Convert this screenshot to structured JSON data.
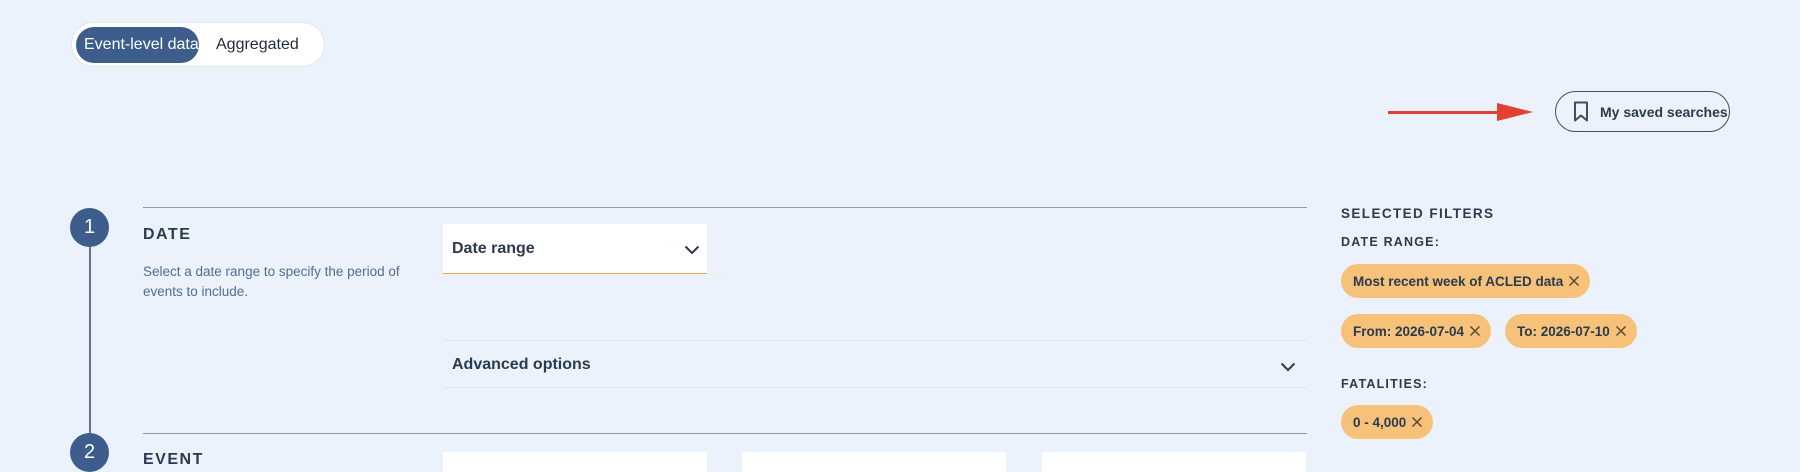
{
  "view_toggle": {
    "active": "Event-level data",
    "inactive": "Aggregated"
  },
  "saved_searches": {
    "label": "My saved searches",
    "icon": "bookmark-icon"
  },
  "annotation": {
    "color": "#e3402f"
  },
  "steps": [
    {
      "number": "1",
      "title": "DATE",
      "description": "Select a date range to specify the period of events to include.",
      "select_value": "Date range",
      "advanced_label": "Advanced options"
    },
    {
      "number": "2",
      "title": "EVENT"
    }
  ],
  "filters": {
    "title": "SELECTED FILTERS",
    "date_range_label": "DATE RANGE:",
    "date_chips": [
      "Most recent week of ACLED data",
      "From: 2026-07-04",
      "To: 2026-07-10"
    ],
    "fatalities_label": "FATALITIES:",
    "fatality_chips": [
      "0 - 4,000"
    ]
  },
  "colors": {
    "background": "#ebf2fb",
    "primary": "#3d5e8c",
    "chip": "#f6c27a",
    "accent_underline": "#e8a84a"
  }
}
